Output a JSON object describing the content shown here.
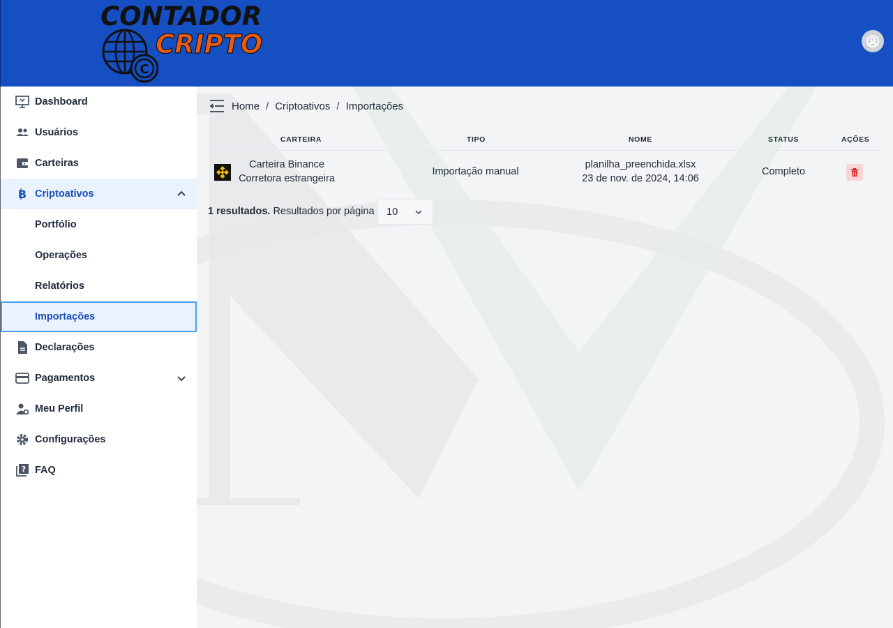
{
  "brand": {
    "line1": "CONTADOR",
    "line2": "CRIPTO",
    "primary_color": "#164fc2",
    "accent_color": "#ea5a12"
  },
  "header": {
    "user_icon": "user-circle-icon"
  },
  "sidebar": {
    "items": [
      {
        "label": "Dashboard",
        "icon": "monitor-icon"
      },
      {
        "label": "Usuários",
        "icon": "users-icon"
      },
      {
        "label": "Carteiras",
        "icon": "wallet-icon"
      },
      {
        "label": "Criptoativos",
        "icon": "bitcoin-icon",
        "expanded": true
      },
      {
        "label": "Portfólio"
      },
      {
        "label": "Operações"
      },
      {
        "label": "Relatórios"
      },
      {
        "label": "Importações",
        "active": true
      },
      {
        "label": "Declarações",
        "icon": "document-icon"
      },
      {
        "label": "Pagamentos",
        "icon": "credit-card-icon",
        "expanded": false
      },
      {
        "label": "Meu Perfil",
        "icon": "user-gear-icon"
      },
      {
        "label": "Configurações",
        "icon": "gear-icon"
      },
      {
        "label": "FAQ",
        "icon": "question-book-icon"
      }
    ]
  },
  "breadcrumb": [
    "Home",
    "Criptoativos",
    "Importações"
  ],
  "table": {
    "headers": [
      "CARTEIRA",
      "TIPO",
      "NOME",
      "STATUS",
      "AÇÕES"
    ],
    "rows": [
      {
        "wallet_name": "Carteira Binance",
        "wallet_type": "Corretora estrangeira",
        "wallet_icon": "binance-icon",
        "tipo": "Importação manual",
        "file_name": "planilha_preenchida.xlsx",
        "date": "23 de nov. de 2024, 14:06",
        "status": "Completo",
        "action_icon": "trash-icon"
      }
    ]
  },
  "pager": {
    "results": "1 resultados.",
    "per_page_label": "Resultados por página",
    "per_page_value": "10"
  }
}
